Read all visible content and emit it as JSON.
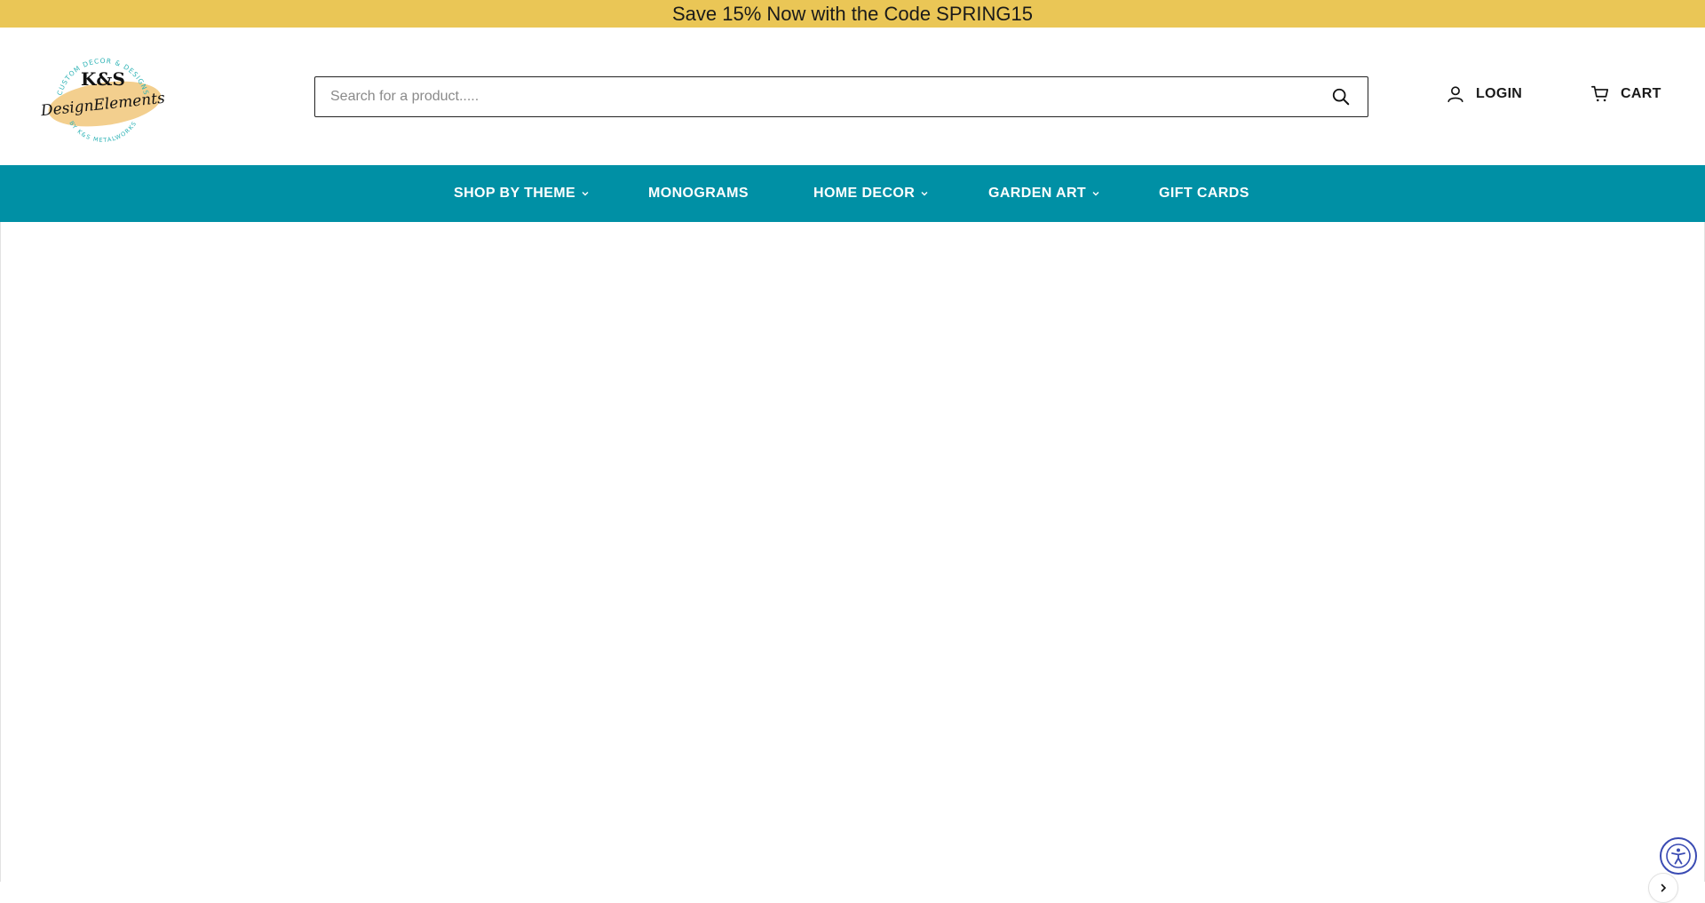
{
  "announcement": "Save 15% Now with the Code SPRING15",
  "logo": {
    "brand_top": "K&S",
    "brand_script": "DesignElements",
    "ring_top": "CUSTOM DECOR & DESIGNS",
    "ring_bottom": "BY K&S METALWORKS"
  },
  "search": {
    "placeholder": "Search for a product.....",
    "value": ""
  },
  "account": {
    "login_label": "LOGIN",
    "cart_label": "CART"
  },
  "nav": {
    "items": [
      {
        "label": "SHOP BY THEME",
        "has_dropdown": true
      },
      {
        "label": "MONOGRAMS",
        "has_dropdown": false
      },
      {
        "label": "HOME DECOR",
        "has_dropdown": true
      },
      {
        "label": "GARDEN ART",
        "has_dropdown": true
      },
      {
        "label": "GIFT CARDS",
        "has_dropdown": false
      }
    ]
  },
  "colors": {
    "announcement_bg": "#eac656",
    "nav_bg": "#0090a5",
    "logo_teal": "#2fb3b6",
    "logo_blob": "#f3cf8e",
    "a11y_blue": "#3a4bb3"
  },
  "icons": {
    "search": "search-icon",
    "login": "user-icon",
    "cart": "cart-icon",
    "dropdown": "chevron-down-icon",
    "carousel_next": "chevron-right-icon",
    "accessibility": "accessibility-icon"
  }
}
